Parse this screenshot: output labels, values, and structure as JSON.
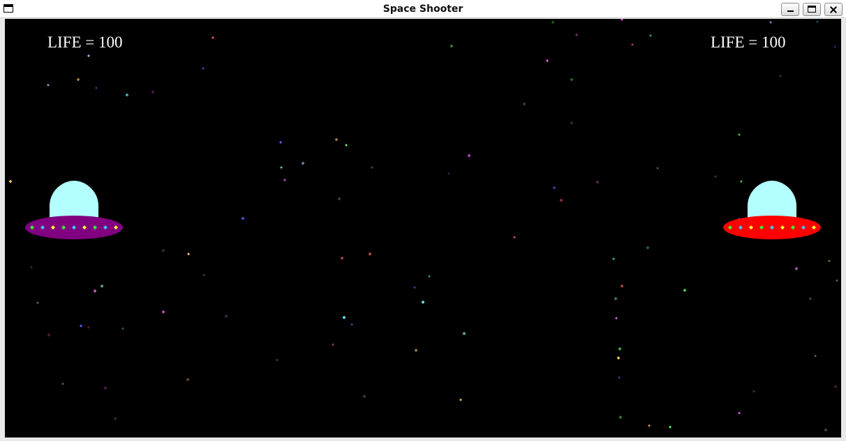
{
  "window": {
    "title": "Space Shooter",
    "controls": [
      "minimize",
      "maximize",
      "close"
    ]
  },
  "hud": {
    "player1": {
      "label": "LIFE = ",
      "life": "100"
    },
    "player2": {
      "label": "LIFE = ",
      "life": "100"
    }
  },
  "ships": {
    "player1": {
      "dome_color": "#b3ffff",
      "saucer_color": "#800080"
    },
    "player2": {
      "dome_color": "#b3ffff",
      "saucer_color": "#ff0000"
    }
  },
  "colors": {
    "background": "#000000",
    "hud_text": "#ffffff",
    "light_colors": [
      "#33ff33",
      "#33ccff",
      "#ffff33"
    ]
  }
}
